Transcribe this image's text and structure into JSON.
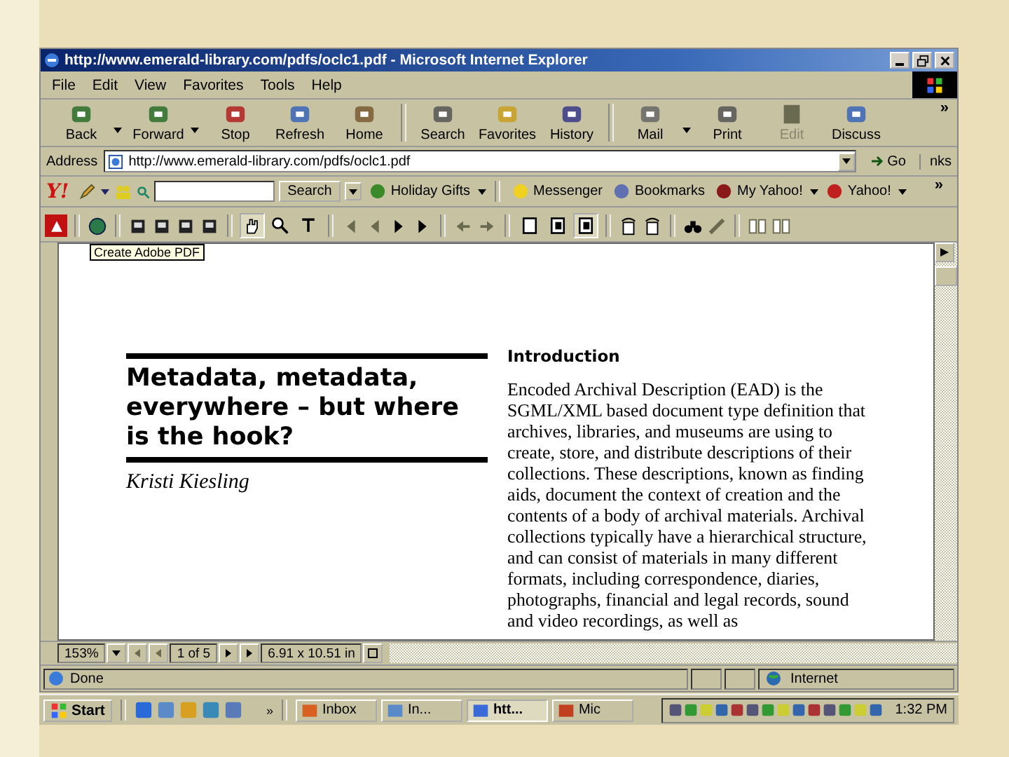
{
  "window": {
    "title": "http://www.emerald-library.com/pdfs/oclc1.pdf - Microsoft Internet Explorer"
  },
  "menu": [
    "File",
    "Edit",
    "View",
    "Favorites",
    "Tools",
    "Help"
  ],
  "toolbar": [
    {
      "label": "Back",
      "disabled": false,
      "dropdown": true
    },
    {
      "label": "Forward",
      "disabled": false,
      "dropdown": true
    },
    {
      "label": "Stop",
      "disabled": false,
      "dropdown": false
    },
    {
      "label": "Refresh",
      "disabled": false,
      "dropdown": false
    },
    {
      "label": "Home",
      "disabled": false,
      "dropdown": false
    },
    {
      "label": "Search",
      "disabled": false,
      "dropdown": false
    },
    {
      "label": "Favorites",
      "disabled": false,
      "dropdown": false
    },
    {
      "label": "History",
      "disabled": false,
      "dropdown": false
    },
    {
      "label": "Mail",
      "disabled": false,
      "dropdown": true
    },
    {
      "label": "Print",
      "disabled": false,
      "dropdown": false
    },
    {
      "label": "Edit",
      "disabled": true,
      "dropdown": false
    },
    {
      "label": "Discuss",
      "disabled": false,
      "dropdown": false
    }
  ],
  "toolbar_more": "»",
  "address": {
    "label": "Address",
    "value": "http://www.emerald-library.com/pdfs/oclc1.pdf",
    "go": "Go",
    "links": "nks"
  },
  "yahoo_bar": {
    "logo": "Y!",
    "search_button": "Search",
    "items": [
      {
        "label": "Holiday Gifts",
        "dropdown": true
      },
      {
        "label": "Messenger",
        "dropdown": false
      },
      {
        "label": "Bookmarks",
        "dropdown": false
      },
      {
        "label": "My Yahoo!",
        "dropdown": true
      },
      {
        "label": "Yahoo!",
        "dropdown": true
      }
    ],
    "more": "»"
  },
  "acrobat": {
    "tools": [
      {
        "selected": true
      },
      {
        "selected": false
      },
      {
        "selected": false
      }
    ],
    "views": [
      {
        "selected": false
      },
      {
        "selected": false
      },
      {
        "selected": true
      }
    ],
    "tooltip": "Create Adobe PDF"
  },
  "document": {
    "title": "Metadata, metadata, everywhere – but where is the hook?",
    "author": "Kristi Kiesling",
    "heading": "Introduction",
    "body": "Encoded Archival Description (EAD) is the SGML/XML based document type definition that archives, libraries, and museums are using to create, store, and distribute descriptions of their collections. These descriptions, known as finding aids, document the context of creation and the contents of a body of archival materials. Archival collections typically have a hierarchical structure, and can consist of materials in many different formats, including correspondence, diaries, photographs, financial and legal records, sound and video recordings, as well as"
  },
  "pdf_status": {
    "zoom": "153%",
    "page": "1 of 5",
    "size": "6.91 x 10.51 in"
  },
  "status_bar": {
    "text": "Done",
    "zone": "Internet"
  },
  "taskbar": {
    "start": "Start",
    "more": "»",
    "tasks": [
      {
        "label": "Inbox",
        "selected": false
      },
      {
        "label": "In...",
        "selected": false
      },
      {
        "label": "htt...",
        "selected": true
      },
      {
        "label": "Mic",
        "selected": false
      }
    ],
    "clock": "1:32 PM"
  }
}
